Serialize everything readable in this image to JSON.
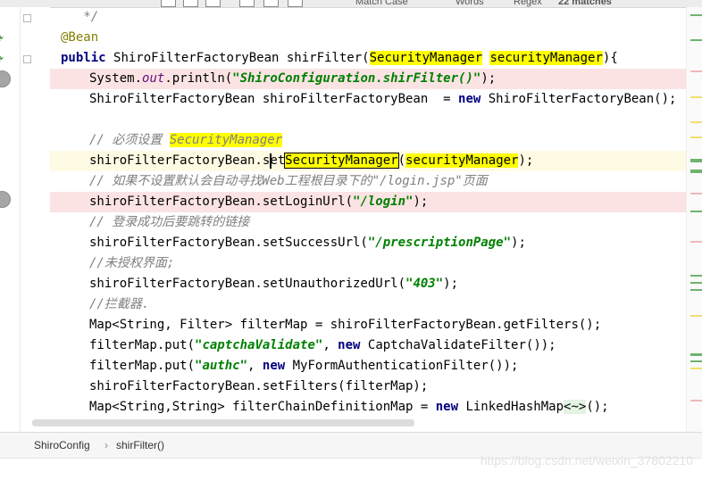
{
  "top_fragments": [
    "Match Case",
    "Words",
    "Regex",
    "22 matches"
  ],
  "editor": {
    "lines": [
      {
        "type": "plain",
        "text": "   */",
        "cls": "cm"
      },
      {
        "type": "plain",
        "text": "@Bean",
        "cls": "ann"
      },
      {
        "type": "segs",
        "segs": [
          [
            "public ",
            "kw"
          ],
          [
            "ShiroFilterFactoryBean shirFilter(",
            ""
          ],
          [
            "SecurityManager",
            "hl"
          ],
          [
            " ",
            ""
          ],
          [
            "securityManager",
            "hl"
          ],
          [
            "){",
            ""
          ]
        ]
      },
      {
        "type": "segs",
        "segs": [
          [
            "System.",
            ""
          ],
          [
            "out",
            "fld"
          ],
          [
            ".println(",
            ""
          ],
          [
            "\"ShiroConfiguration.shirFilter()\"",
            "str"
          ],
          [
            ");",
            ""
          ]
        ]
      },
      {
        "type": "segs",
        "segs": [
          [
            "ShiroFilterFactoryBean shiroFilterFactoryBean  = ",
            ""
          ],
          [
            "new ",
            "kw"
          ],
          [
            "ShiroFilterFactoryBean();",
            ""
          ]
        ]
      },
      {
        "type": "blank"
      },
      {
        "type": "segs",
        "segs": [
          [
            "// 必须设置 ",
            "cm"
          ],
          [
            "SecurityManager",
            "hlcm"
          ]
        ]
      },
      {
        "type": "segs",
        "segs": [
          [
            "shiroFilterFactoryBean.",
            ""
          ],
          [
            "s",
            "caretwrap"
          ],
          [
            "et",
            ""
          ],
          [
            "SecurityManager",
            "hlcur"
          ],
          [
            "(",
            ""
          ],
          [
            "securityManager",
            "hl"
          ],
          [
            ");",
            ""
          ]
        ]
      },
      {
        "type": "segs",
        "segs": [
          [
            "// 如果不设置默认会自动寻找",
            "cm"
          ],
          [
            "Web",
            "cmi"
          ],
          [
            "工程根目录下的",
            "cm"
          ],
          [
            "\"/login.jsp\"",
            "cmi"
          ],
          [
            "页面",
            "cm"
          ]
        ]
      },
      {
        "type": "segs",
        "segs": [
          [
            "shiroFilterFactoryBean.setLoginUrl(",
            ""
          ],
          [
            "\"/login\"",
            "str"
          ],
          [
            ");",
            ""
          ]
        ]
      },
      {
        "type": "segs",
        "segs": [
          [
            "// 登录成功后要跳转的链接",
            "cm"
          ]
        ]
      },
      {
        "type": "segs",
        "segs": [
          [
            "shiroFilterFactoryBean.setSuccessUrl(",
            ""
          ],
          [
            "\"/prescriptionPage\"",
            "str"
          ],
          [
            ");",
            ""
          ]
        ]
      },
      {
        "type": "segs",
        "segs": [
          [
            "//未授权界面;",
            "cm"
          ]
        ]
      },
      {
        "type": "segs",
        "segs": [
          [
            "shiroFilterFactoryBean.setUnauthorizedUrl(",
            ""
          ],
          [
            "\"403\"",
            "str"
          ],
          [
            ");",
            ""
          ]
        ]
      },
      {
        "type": "segs",
        "segs": [
          [
            "//拦截器.",
            "cm"
          ]
        ]
      },
      {
        "type": "segs",
        "segs": [
          [
            "Map<String, Filter> filterMap = shiroFilterFactoryBean.getFilters();",
            ""
          ]
        ]
      },
      {
        "type": "segs",
        "segs": [
          [
            "filterMap.put(",
            ""
          ],
          [
            "\"captchaValidate\"",
            "str"
          ],
          [
            ", ",
            ""
          ],
          [
            "new ",
            "kw"
          ],
          [
            "CaptchaValidateFilter());",
            ""
          ]
        ]
      },
      {
        "type": "segs",
        "segs": [
          [
            "filterMap.put(",
            ""
          ],
          [
            "\"authc\"",
            "str"
          ],
          [
            ", ",
            ""
          ],
          [
            "new ",
            "kw"
          ],
          [
            "MyFormAuthenticationFilter());",
            ""
          ]
        ]
      },
      {
        "type": "segs",
        "segs": [
          [
            "shiroFilterFactoryBean.setFilters(filterMap);",
            ""
          ]
        ]
      },
      {
        "type": "segs",
        "segs": [
          [
            "Map<String,String> filterChainDefinitionMap = ",
            ""
          ],
          [
            "new ",
            "kw"
          ],
          [
            "LinkedHashMap",
            ""
          ],
          [
            "<~>",
            "tag"
          ],
          [
            "();",
            ""
          ]
        ]
      }
    ]
  },
  "breadcrumb": {
    "class": "ShiroConfig",
    "method": "shirFilter()",
    "sep": "›"
  },
  "watermark": "https://blog.csdn.net/weixin_37802210",
  "colors": {
    "keyword": "#000080",
    "string": "#008000",
    "comment": "#808080",
    "annotation": "#808000",
    "highlight": "#ffff00",
    "error_line": "#fbe3e4"
  }
}
